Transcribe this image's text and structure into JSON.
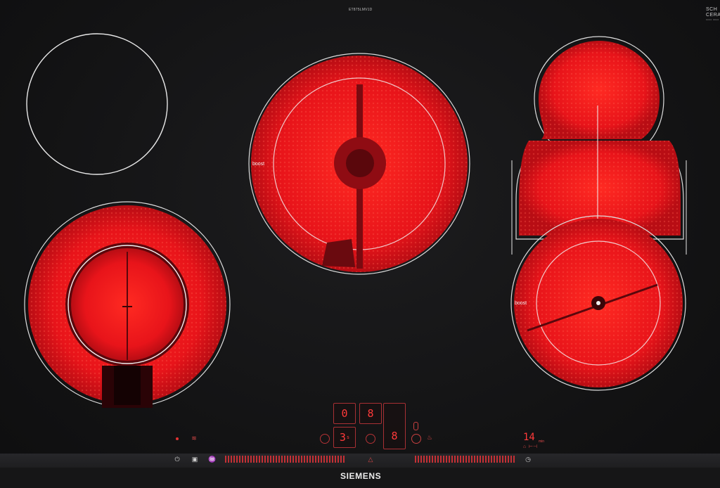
{
  "header": {
    "model_code": "ET875LMV1D",
    "brand_corner_line1": "SCH",
    "brand_corner_line2": "CERA",
    "brand_corner_sub": "9000 9826 00"
  },
  "zones": {
    "top_left": {
      "state": "off"
    },
    "center": {
      "state": "on",
      "boost_label": "boost"
    },
    "bottom_left": {
      "state": "on"
    },
    "right_roaster": {
      "state": "on"
    },
    "right_round": {
      "state": "on",
      "boost_label": "boost"
    }
  },
  "controls": {
    "display_left_top": "0",
    "display_right_top": "8",
    "display_left_bottom": "3",
    "display_left_bottom_suffix": "s",
    "display_right_bottom": "8",
    "timer_value": "14",
    "timer_unit": "min",
    "power_icon": "power-icon",
    "lock_icon": "child-lock-icon",
    "wipe_icon": "wipe-protection-icon",
    "timer_icon": "clock-icon",
    "keep_warm_icon": "keep-warm-icon",
    "fry_sensor_icon": "frying-sensor-icon"
  },
  "footer": {
    "brand": "SIEMENS"
  },
  "colors": {
    "glass": "#141415",
    "zone_hot": "#e3161c",
    "zone_outline": "#e6e6e6",
    "display_red": "#ff3a3a"
  }
}
